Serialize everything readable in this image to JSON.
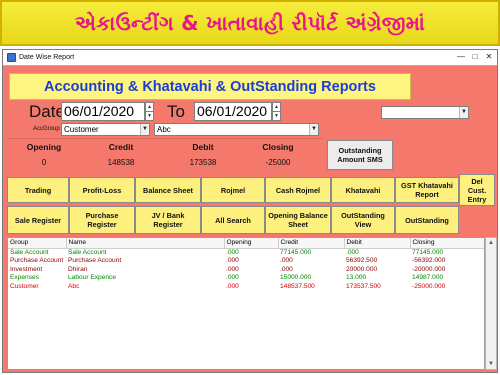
{
  "banner": {
    "text": "એકાઉન્ટીંગ & ખાતાવાહી રીપૉર્ટ અંગ્રેજીમાં"
  },
  "window": {
    "title": "Date Wise Report",
    "min": "—",
    "max": "□",
    "close": "✕"
  },
  "report_title": "Accounting & Khatavahi & OutStanding Reports",
  "filters": {
    "date_label": "Date",
    "date_from": "06/01/2020",
    "to_label": "To",
    "date_to": "06/01/2020",
    "group_label": "AccGroup",
    "group_value": "Customer",
    "account_value": "Abc",
    "extra_value": ""
  },
  "summary": {
    "opening_label": "Opening",
    "opening_value": "0",
    "credit_label": "Credit",
    "credit_value": "148538",
    "debit_label": "Debit",
    "debit_value": "173538",
    "closing_label": "Closing",
    "closing_value": "-25000",
    "sms_button": "Outstanding Amount SMS"
  },
  "buttons_row1": [
    "Trading",
    "Profit-Loss",
    "Balance Sheet",
    "Rojmel",
    "Cash Rojmel",
    "Khatavahi",
    "GST Khatavahi Report",
    "Del Cust. Entry"
  ],
  "buttons_row2": [
    "Sale Register",
    "Purchase Register",
    "JV / Bank Register",
    "All Search",
    "Opening Balance Sheet",
    "OutStanding View",
    "OutStanding"
  ],
  "table": {
    "headers": [
      "Group",
      "Name",
      "Opening",
      "Credit",
      "Debit",
      "Closing"
    ],
    "rows": [
      [
        "Sale Account",
        "Sale Account",
        ".000",
        "77145.000",
        ".000",
        "77145.000"
      ],
      [
        "Purchase Account",
        "Purchase Account",
        ".000",
        ".000",
        "56392.500",
        "-56392.000"
      ],
      [
        "Investment",
        "Dhiran",
        ".000",
        ".000",
        "20000.000",
        "-20000.000"
      ],
      [
        "Expenses",
        "Labour Expence",
        ".000",
        "15000.000",
        "13.000",
        "14987.000"
      ],
      [
        "Customer",
        "Abc",
        ".000",
        "148537.500",
        "173537.500",
        "-25000.000"
      ]
    ]
  },
  "icons": {
    "spin_up": "▲",
    "spin_down": "▼",
    "dropdown": "▼",
    "scroll_up": "▲",
    "scroll_down": "▼"
  },
  "colors": {
    "banner_text": "#e8148c",
    "title_text": "#1a3dd8",
    "window_bg": "#f4796c",
    "button_bg": "#fdf07e"
  }
}
